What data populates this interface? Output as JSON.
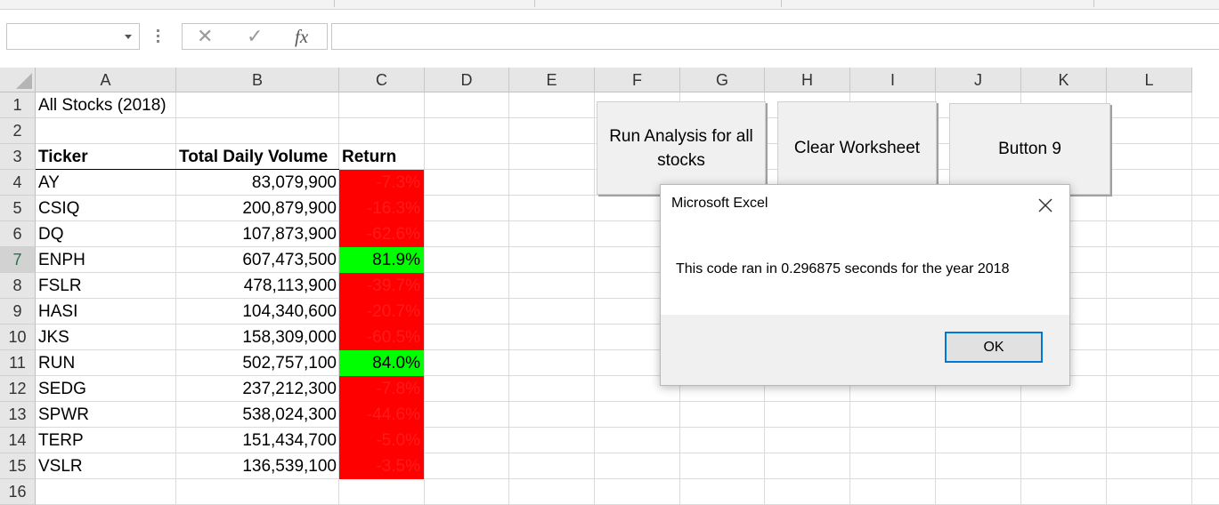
{
  "formula_bar": {
    "name_box_value": "",
    "formula_value": ""
  },
  "columns": [
    "A",
    "B",
    "C",
    "D",
    "E",
    "F",
    "G",
    "H",
    "I",
    "J",
    "K",
    "L"
  ],
  "rows": [
    "1",
    "2",
    "3",
    "4",
    "5",
    "6",
    "7",
    "8",
    "9",
    "10",
    "11",
    "12",
    "13",
    "14",
    "15",
    "16"
  ],
  "selected_row": "7",
  "sheet": {
    "title": "All Stocks (2018)",
    "headers": {
      "ticker": "Ticker",
      "volume": "Total Daily Volume",
      "return": "Return"
    },
    "data": [
      {
        "ticker": "AY",
        "volume": "83,079,900",
        "return": "-7.3%",
        "positive": false
      },
      {
        "ticker": "CSIQ",
        "volume": "200,879,900",
        "return": "-16.3%",
        "positive": false
      },
      {
        "ticker": "DQ",
        "volume": "107,873,900",
        "return": "-62.6%",
        "positive": false
      },
      {
        "ticker": "ENPH",
        "volume": "607,473,500",
        "return": "81.9%",
        "positive": true
      },
      {
        "ticker": "FSLR",
        "volume": "478,113,900",
        "return": "-39.7%",
        "positive": false
      },
      {
        "ticker": "HASI",
        "volume": "104,340,600",
        "return": "-20.7%",
        "positive": false
      },
      {
        "ticker": "JKS",
        "volume": "158,309,000",
        "return": "-60.5%",
        "positive": false
      },
      {
        "ticker": "RUN",
        "volume": "502,757,100",
        "return": "84.0%",
        "positive": true
      },
      {
        "ticker": "SEDG",
        "volume": "237,212,300",
        "return": "-7.8%",
        "positive": false
      },
      {
        "ticker": "SPWR",
        "volume": "538,024,300",
        "return": "-44.6%",
        "positive": false
      },
      {
        "ticker": "TERP",
        "volume": "151,434,700",
        "return": "-5.0%",
        "positive": false
      },
      {
        "ticker": "VSLR",
        "volume": "136,539,100",
        "return": "-3.5%",
        "positive": false
      }
    ]
  },
  "buttons": {
    "run_analysis": "Run Analysis for all stocks",
    "clear_worksheet": "Clear Worksheet",
    "button9": "Button 9"
  },
  "dialog": {
    "title": "Microsoft Excel",
    "message": "This code ran in 0.296875 seconds for the year 2018",
    "ok": "OK"
  },
  "colors": {
    "negative_fill": "#ff0000",
    "positive_fill": "#00ff00",
    "accent": "#0078d7",
    "selection": "#217346"
  },
  "icons": [
    "cancel-icon",
    "enter-icon",
    "function-icon",
    "close-icon",
    "dropdown-icon"
  ]
}
